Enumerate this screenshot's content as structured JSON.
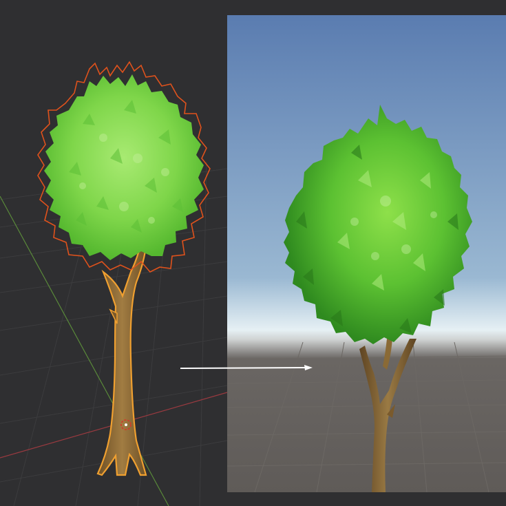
{
  "scene": {
    "editor_viewport": "3d-editor-viewport",
    "game_preview": "game-preview",
    "colors": {
      "editor_background": "#2f2f31",
      "selection_outline": "#e0521c",
      "trunk_selection_outline": "#f0a030",
      "sky_top": "#5a7cb0",
      "sky_horizon": "#e6f0f4",
      "ground": "#5f5b58",
      "foliage_light": "#8ee04a",
      "foliage_dark": "#2f8a1f",
      "bark": "#8a6a36"
    },
    "icons": {
      "pivot": "pivot-gizmo-icon",
      "arrow": "arrow-right-icon"
    }
  }
}
